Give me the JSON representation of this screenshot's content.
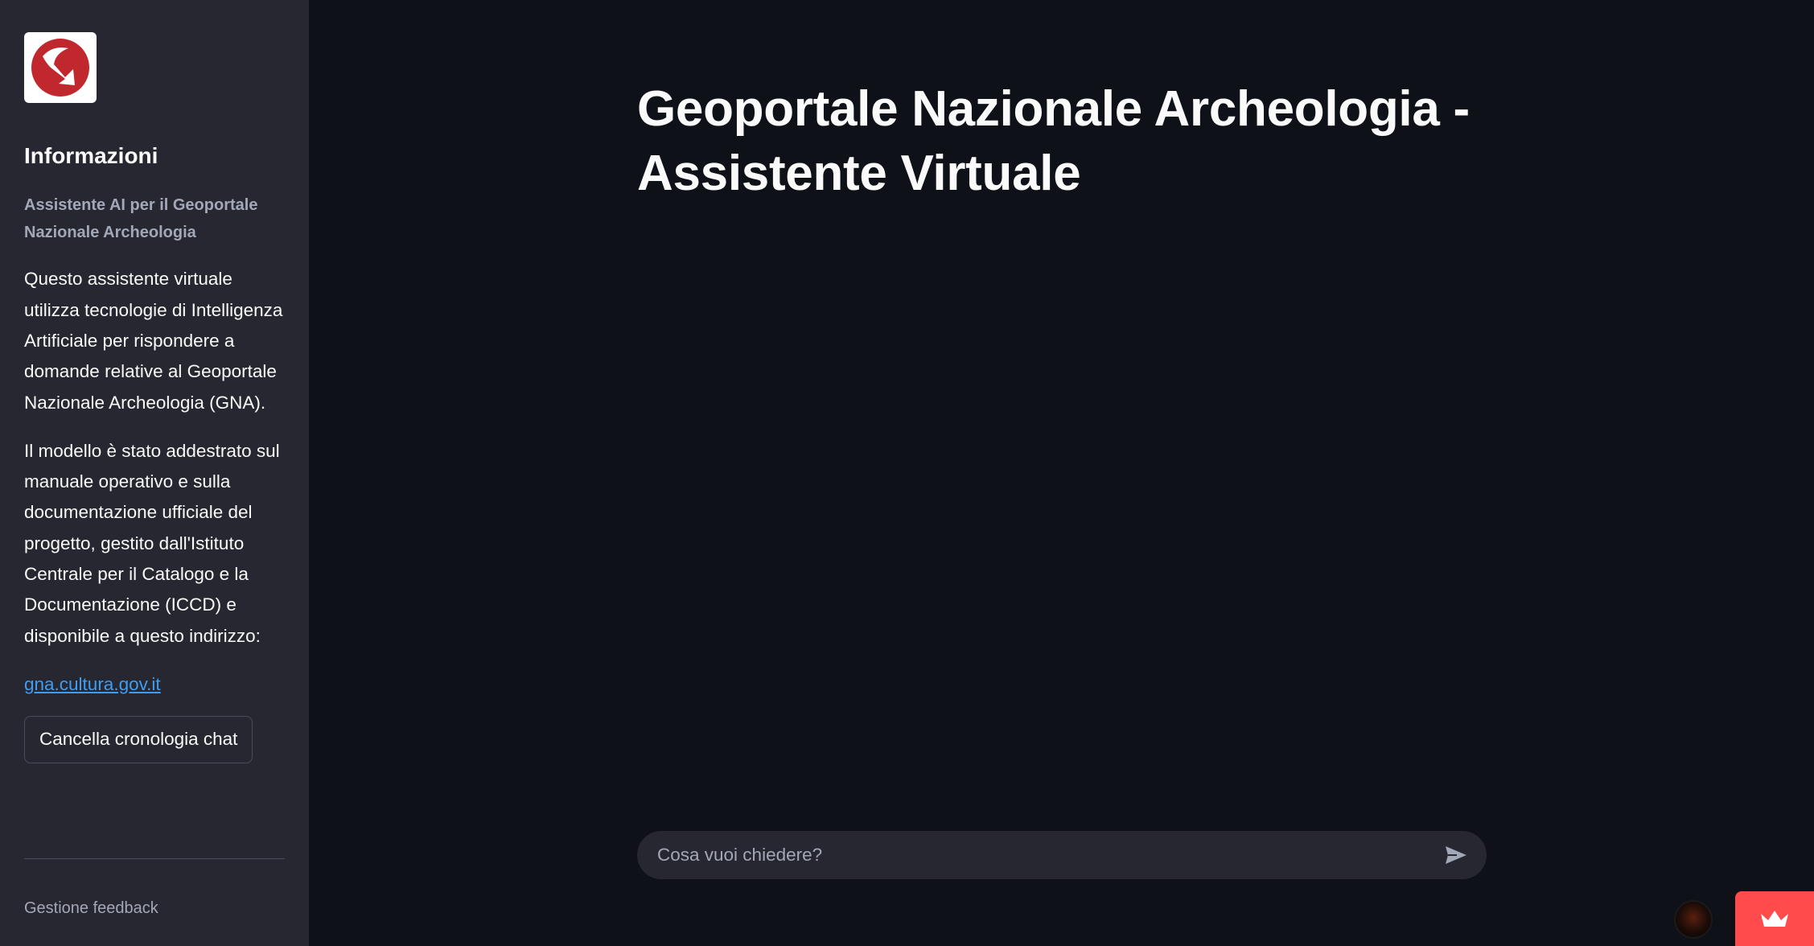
{
  "sidebar": {
    "logo_icon": "gna-logo",
    "heading": "Informazioni",
    "caption": "Assistente AI per il Geoportale Nazionale Archeologia",
    "paragraph1": "Questo assistente virtuale utilizza tecnologie di Intelligenza Artificiale per rispondere a domande relative al Geoportale Nazionale Archeologia (GNA).",
    "paragraph2": "Il modello è stato addestrato sul manuale operativo e sulla documentazione ufficiale del progetto, gestito dall'Istituto Centrale per il Catalogo e la Documentazione (ICCD) e disponibile a questo indirizzo:",
    "link": "gna.cultura.gov.it",
    "clear_button": "Cancella cronologia chat",
    "feedback": "Gestione feedback"
  },
  "main": {
    "title": "Geoportale Nazionale Archeologia - Assistente Virtuale"
  },
  "chat": {
    "placeholder": "Cosa vuoi chiedere?",
    "send_icon": "send-icon"
  },
  "footer": {
    "avatar_icon": "user-avatar",
    "badge_icon": "crown-icon"
  },
  "colors": {
    "background": "#0e1117",
    "sidebar": "#262730",
    "accent": "#ff4b4b",
    "link": "#3d9df3",
    "logo_red": "#c0282d"
  }
}
